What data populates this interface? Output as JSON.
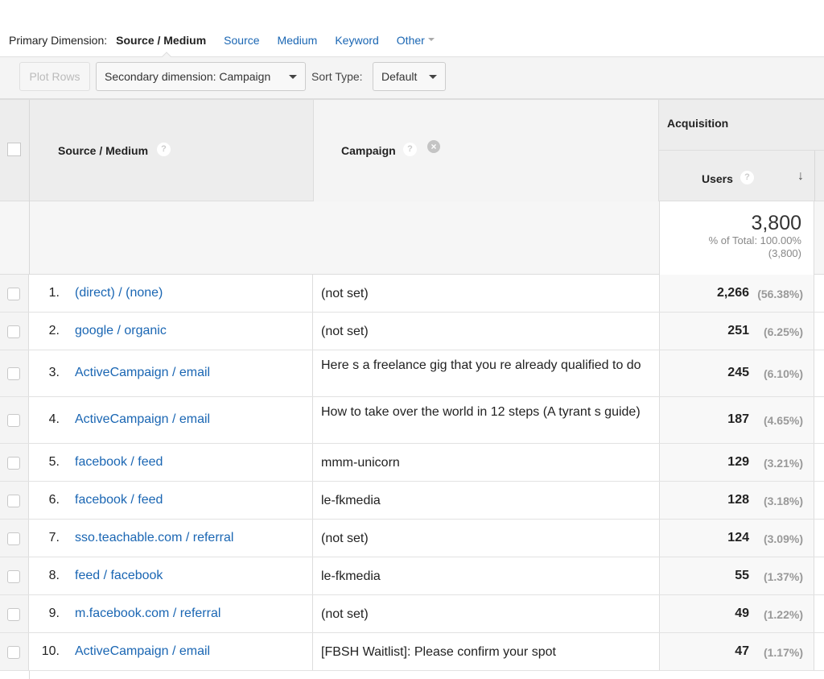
{
  "primary_dimension": {
    "label": "Primary Dimension:",
    "active": "Source / Medium",
    "options": [
      "Source",
      "Medium",
      "Keyword",
      "Other"
    ]
  },
  "toolbar": {
    "plot_rows_label": "Plot Rows",
    "secondary_dimension_label": "Secondary dimension: Campaign",
    "sort_type_label": "Sort Type:",
    "sort_type_value": "Default"
  },
  "table": {
    "headers": {
      "source_medium": "Source / Medium",
      "campaign": "Campaign",
      "acquisition": "Acquisition",
      "users": "Users",
      "help_glyph": "?",
      "close_glyph": "×",
      "sort_glyph": "↓"
    },
    "totals": {
      "users": "3,800",
      "pct_line": "% of Total: 100.00%",
      "abs_line": "(3,800)"
    },
    "rows": [
      {
        "index": "1.",
        "source_medium": "(direct) / (none)",
        "campaign": "(not set)",
        "users": "2,266",
        "pct": "(56.38%)"
      },
      {
        "index": "2.",
        "source_medium": "google / organic",
        "campaign": "(not set)",
        "users": "251",
        "pct": "(6.25%)"
      },
      {
        "index": "3.",
        "source_medium": "ActiveCampaign / email",
        "campaign": "Here s a freelance gig that you re already qualified to do",
        "users": "245",
        "pct": "(6.10%)"
      },
      {
        "index": "4.",
        "source_medium": "ActiveCampaign / email",
        "campaign": "How to take over the world in 12 steps (A tyrant s guide)",
        "users": "187",
        "pct": "(4.65%)"
      },
      {
        "index": "5.",
        "source_medium": "facebook / feed",
        "campaign": "mmm-unicorn",
        "users": "129",
        "pct": "(3.21%)"
      },
      {
        "index": "6.",
        "source_medium": "facebook / feed",
        "campaign": "le-fkmedia",
        "users": "128",
        "pct": "(3.18%)"
      },
      {
        "index": "7.",
        "source_medium": "sso.teachable.com / referral",
        "campaign": "(not set)",
        "users": "124",
        "pct": "(3.09%)"
      },
      {
        "index": "8.",
        "source_medium": "feed / facebook",
        "campaign": "le-fkmedia",
        "users": "55",
        "pct": "(1.37%)"
      },
      {
        "index": "9.",
        "source_medium": "m.facebook.com / referral",
        "campaign": "(not set)",
        "users": "49",
        "pct": "(1.22%)"
      },
      {
        "index": "10.",
        "source_medium": "ActiveCampaign / email",
        "campaign": "[FBSH Waitlist]: Please confirm your spot",
        "users": "47",
        "pct": "(1.17%)"
      }
    ]
  },
  "colors": {
    "link": "#1a66b3",
    "header_bg": "#ededed",
    "muted": "#999999"
  }
}
